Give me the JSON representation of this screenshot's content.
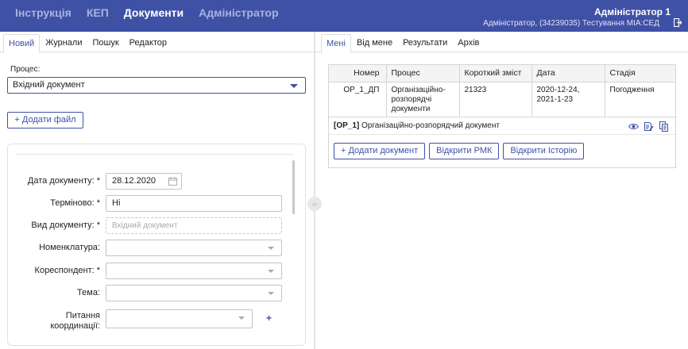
{
  "header": {
    "nav": [
      "Інструкція",
      "КЕП",
      "Документи",
      "Адміністратор"
    ],
    "active_nav": "Документи",
    "user_name": "Адміністратор 1",
    "user_info": "Адміністратор, (34239035) Тестування МІА:СЕД"
  },
  "left_panel": {
    "tabs": [
      "Новий",
      "Журнали",
      "Пошук",
      "Редактор"
    ],
    "active_tab": "Новий",
    "process_label": "Процес:",
    "process_value": "Вхідний документ",
    "add_file_label": "+ Додати файл",
    "form": {
      "date_label": "Дата документу: *",
      "date_value": "28.12.2020",
      "urgent_label": "Терміново: *",
      "urgent_value": "Ні",
      "doc_type_label": "Вид документу: *",
      "doc_type_value": "Вхідний документ",
      "nomenclature_label": "Номенклатура:",
      "nomenclature_value": "",
      "correspondent_label": "Кореспондент: *",
      "correspondent_value": "",
      "topic_label": "Тема:",
      "topic_value": "",
      "coordination_label": "Питання координації:",
      "coordination_value": "",
      "coordination_add": "+"
    }
  },
  "right_panel": {
    "tabs": [
      "Мені",
      "Від мене",
      "Результати",
      "Архів"
    ],
    "active_tab": "Мені",
    "table": {
      "columns": [
        "Номер",
        "Процес",
        "Короткий зміст",
        "Дата",
        "Стадія"
      ],
      "rows": [
        {
          "number": "OP_1_ДП",
          "process": "Організаційно-розпорядчі документи",
          "summary": "21323",
          "date": "2020-12-24, 2021-1-23",
          "stage": "Погодження"
        }
      ]
    },
    "detail": {
      "code": "[OP_1]",
      "title": "Організаційно-розпорядчий документ"
    },
    "buttons": [
      "+ Додати документ",
      "Відкрити РМК",
      "Відкрити Історію"
    ]
  },
  "colors": {
    "brand": "#3f51a5"
  },
  "icons": [
    "exit-icon",
    "calendar-icon",
    "chevron-down-icon",
    "eye-icon",
    "edit-document-icon",
    "copy-document-icon",
    "collapse-handle-icon"
  ]
}
